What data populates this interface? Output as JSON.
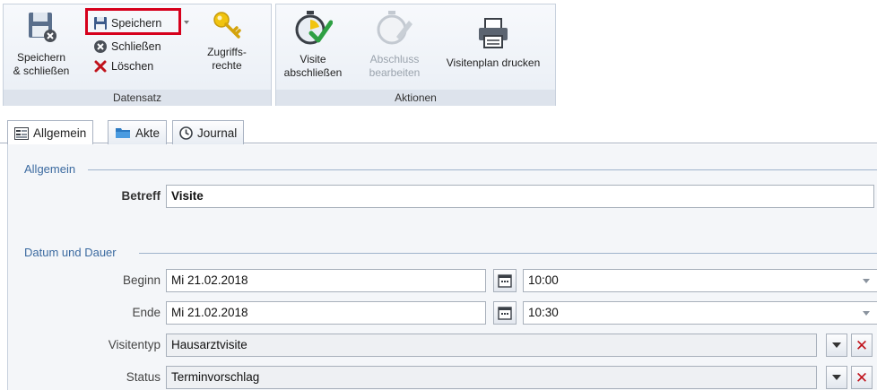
{
  "ribbon": {
    "group_datensatz": {
      "label": "Datensatz",
      "save_close": "Speichern\n& schließen",
      "save": "Speichern",
      "close": "Schließen",
      "delete": "Löschen",
      "access": "Zugriffs-\nrechte"
    },
    "group_aktionen": {
      "label": "Aktionen",
      "finish_visit": "Visite\nabschließen",
      "edit_finish": "Abschluss\nbearbeiten",
      "print_plan": "Visitenplan drucken"
    }
  },
  "tabs": [
    {
      "label": "Allgemein",
      "icon": "form-icon"
    },
    {
      "label": "Akte",
      "icon": "folder-icon"
    },
    {
      "label": "Journal",
      "icon": "clock-icon"
    }
  ],
  "sections": {
    "general": {
      "title": "Allgemein",
      "subject_label": "Betreff",
      "subject_value": "Visite"
    },
    "date": {
      "title": "Datum und Dauer",
      "start_label": "Beginn",
      "start_date": "Mi 21.02.2018",
      "start_time": "10:00",
      "end_label": "Ende",
      "end_date": "Mi 21.02.2018",
      "end_time": "10:30",
      "type_label": "Visitentyp",
      "type_value": "Hausarztvisite",
      "status_label": "Status",
      "status_value": "Terminvorschlag"
    }
  },
  "colors": {
    "highlight": "#d6001c",
    "section_title": "#3b6aa0",
    "delete_red": "#c0121b",
    "check_green": "#2ea043"
  }
}
